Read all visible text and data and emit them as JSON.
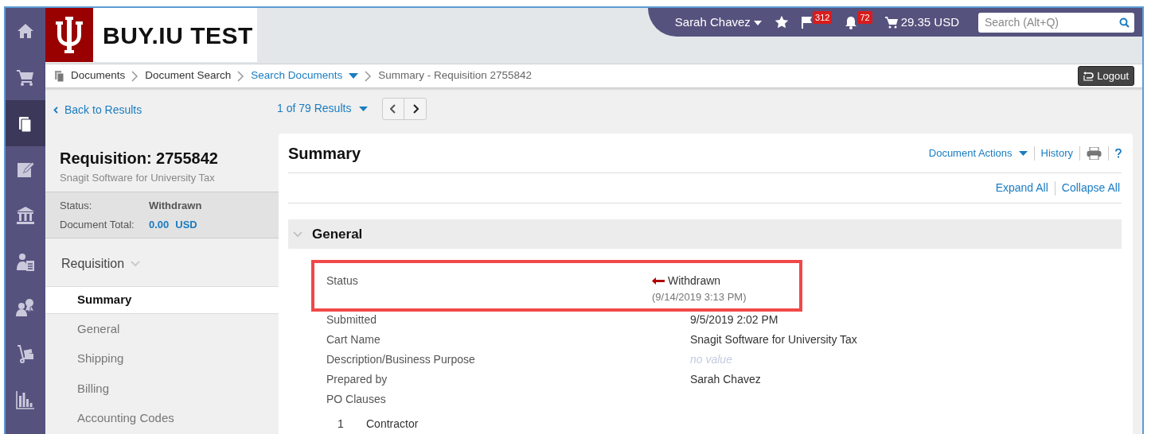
{
  "rail": [
    {
      "kind": "home",
      "selected": false
    },
    {
      "kind": "cart",
      "selected": false
    },
    {
      "kind": "documents",
      "selected": true
    },
    {
      "kind": "edit",
      "selected": false
    },
    {
      "kind": "bank",
      "selected": false
    },
    {
      "kind": "clipboard-person",
      "selected": false
    },
    {
      "kind": "award-person",
      "selected": false
    },
    {
      "kind": "hand-truck",
      "selected": false
    },
    {
      "kind": "chart",
      "selected": false
    }
  ],
  "logo": {
    "text": "BUY.IU TEST"
  },
  "user_bar": {
    "user": "Sarah Chavez",
    "flag_count": "312",
    "alert_count": "72",
    "cart_total": "29.35 USD",
    "search": {
      "placeholder": "Search (Alt+Q)"
    }
  },
  "breadcrumb": [
    {
      "label": "Documents",
      "kind": "icon"
    },
    {
      "label": "Document Search",
      "kind": "plain"
    },
    {
      "label": "Search Documents",
      "kind": "dropdown"
    },
    {
      "label": "Summary - Requisition 2755842",
      "kind": "current"
    }
  ],
  "logout": "Logout",
  "back_link": "Back to Results",
  "results": "1 of 79 Results",
  "document": {
    "title": "Requisition: 2755842",
    "subtitle": "Snagit Software for University Tax",
    "status_label": "Status:",
    "status": "Withdrawn",
    "total_label": "Document Total:",
    "total": "0.00",
    "currency": "USD"
  },
  "nav": {
    "heading": "Requisition",
    "items": [
      {
        "label": "Summary",
        "selected": true
      },
      {
        "label": "General",
        "selected": false
      },
      {
        "label": "Shipping",
        "selected": false
      },
      {
        "label": "Billing",
        "selected": false
      },
      {
        "label": "Accounting Codes",
        "selected": false
      }
    ]
  },
  "summary": {
    "title": "Summary",
    "actions": [
      "Document Actions",
      "History"
    ],
    "expand": "Expand All",
    "collapse": "Collapse All",
    "section": {
      "title": "General",
      "expanded": true,
      "fields": [
        {
          "label": "Status",
          "value": "Withdrawn",
          "note": "(9/14/2019 3:13 PM)",
          "kind": "status",
          "highlighted": true
        },
        {
          "label": "Submitted",
          "value": "9/5/2019 2:02 PM",
          "kind": "text",
          "highlighted": false
        },
        {
          "label": "Cart Name",
          "value": "Snagit Software for University Tax",
          "kind": "text",
          "highlighted": false
        },
        {
          "label": "Description/Business Purpose",
          "value": "no value",
          "kind": "empty",
          "highlighted": false
        },
        {
          "label": "Prepared by",
          "value": "Sarah Chavez",
          "kind": "text",
          "highlighted": false
        },
        {
          "label": "PO Clauses",
          "kind": "heading",
          "highlighted": false
        }
      ],
      "clauses": [
        {
          "number": "1",
          "text": "Contractor"
        }
      ]
    }
  }
}
